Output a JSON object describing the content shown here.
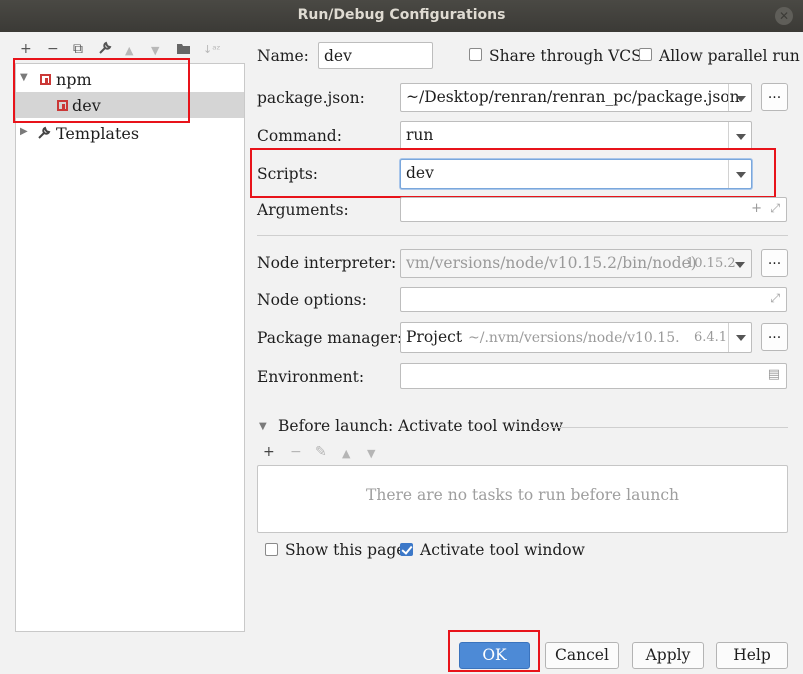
{
  "window": {
    "title": "Run/Debug Configurations"
  },
  "toolbar": {
    "add": "+",
    "remove": "−",
    "copy": "⧉",
    "edit": "🔧",
    "up": "▲",
    "down": "▼",
    "folder": "▣",
    "sort": "↓ᵃᶻ"
  },
  "tree": {
    "npm_label": "npm",
    "dev_label": "dev",
    "templates_label": "Templates"
  },
  "form": {
    "name_label": "Name:",
    "name_value": "dev",
    "share_vcs_label": "Share through VCS",
    "allow_parallel_label": "Allow parallel run",
    "packagejson_label": "package.json:",
    "packagejson_value": "~/Desktop/renran/renran_pc/package.json",
    "command_label": "Command:",
    "command_value": "run",
    "scripts_label": "Scripts:",
    "scripts_value": "dev",
    "arguments_label": "Arguments:",
    "arguments_value": "",
    "node_interpreter_label": "Node interpreter:",
    "node_interpreter_value": "vm/versions/node/v10.15.2/bin/node)",
    "node_interpreter_version": "10.15.2",
    "node_options_label": "Node options:",
    "node_options_value": "",
    "package_manager_label": "Package manager:",
    "package_manager_value": "Project",
    "package_manager_path": "~/.nvm/versions/node/v10.15.",
    "package_manager_version": "6.4.1",
    "environment_label": "Environment:",
    "environment_value": "",
    "browse_label": "..."
  },
  "before_launch": {
    "header": "Before launch: Activate tool window",
    "add": "+",
    "remove": "−",
    "edit": "✎",
    "up": "▲",
    "down": "▼",
    "empty_text": "There are no tasks to run before launch",
    "show_page_label": "Show this page",
    "activate_label": "Activate tool window"
  },
  "buttons": {
    "ok": "OK",
    "cancel": "Cancel",
    "apply": "Apply",
    "help": "Help"
  },
  "checkboxes": {
    "share_vcs": false,
    "allow_parallel": false,
    "show_this_page": false,
    "activate_tool_window": true
  },
  "colors": {
    "accent": "#4d8ad6",
    "highlight": "#e8131a",
    "npm_red": "#cb3837",
    "titlebar": "#3c3b37"
  }
}
